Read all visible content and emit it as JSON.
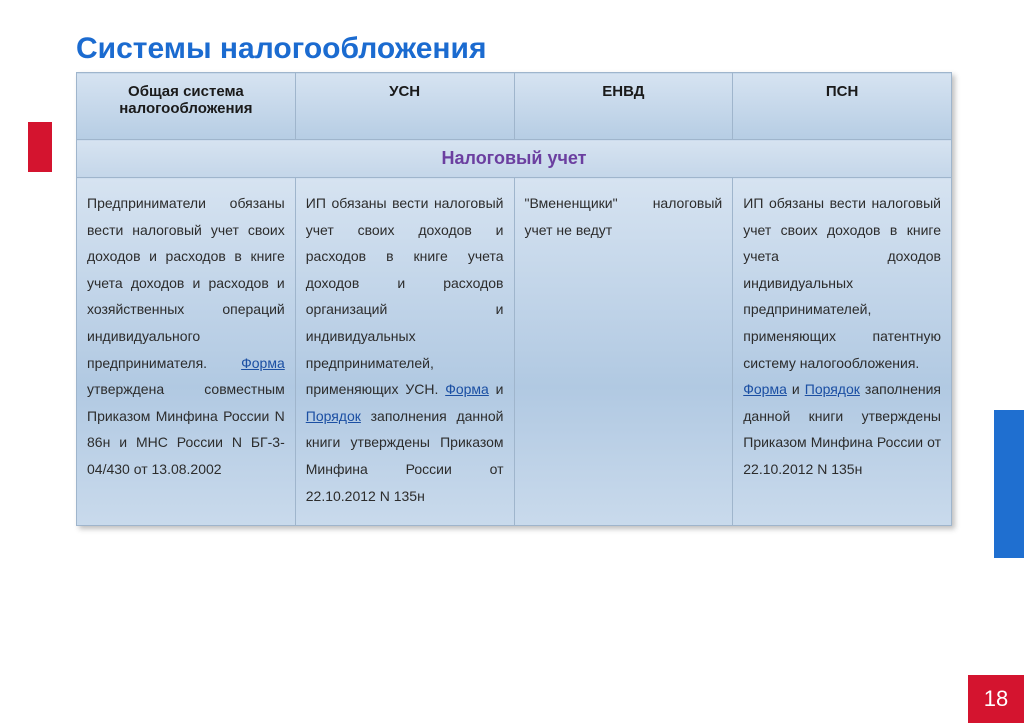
{
  "title": "Системы  налогообложения",
  "page_number": "18",
  "headers": {
    "col1": "Общая система налогообложения",
    "col2": "УСН",
    "col3": "ЕНВД",
    "col4": "ПСН"
  },
  "section": "Налоговый учет",
  "cells": {
    "c1_a": "Предприниматели обязаны вести налоговый учет своих доходов и расходов в книге учета доходов и расходов и хозяйственных операций индивидуального предпринимателя. ",
    "c1_link": "Форма",
    "c1_b": " утверждена совместным Приказом Минфина России N 86н и МНС России N БГ-3-04/430 от 13.08.2002",
    "c2_a": "ИП обязаны вести налоговый учет своих доходов и расходов в книге учета доходов и расходов организаций и индивидуальных предпринимателей, применяющих УСН. ",
    "c2_link1": "Форма",
    "c2_mid": " и ",
    "c2_link2": "Порядок",
    "c2_b": " заполнения данной книги утверждены Приказом Минфина России от 22.10.2012 N 135н",
    "c3": "\"Вмененщики\" налоговый учет не ведут",
    "c4_a": "ИП обязаны вести налоговый учет своих доходов в книге учета доходов индивидуальных предпринимателей, применяющих патентную систему налогообложения.",
    "c4_link1": "Форма",
    "c4_mid": " и ",
    "c4_link2": "Порядок",
    "c4_b": " заполнения данной книги утверждены Приказом Минфина России от 22.10.2012 N 135н"
  }
}
